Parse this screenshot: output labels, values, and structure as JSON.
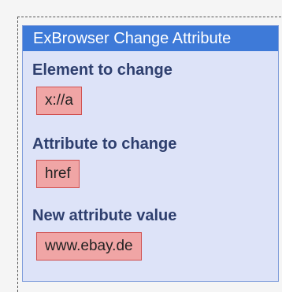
{
  "activity": {
    "title": "ExBrowser Change Attribute",
    "fields": [
      {
        "label": "Element to change",
        "value": "x://a"
      },
      {
        "label": "Attribute to change",
        "value": "href"
      },
      {
        "label": "New attribute value",
        "value": "www.ebay.de"
      }
    ]
  },
  "colors": {
    "header_bg": "#3e7ad8",
    "panel_bg": "#dde3f8",
    "label_text": "#2e3f6e",
    "field_bg": "#f0a5a5",
    "field_border": "#d05050"
  }
}
